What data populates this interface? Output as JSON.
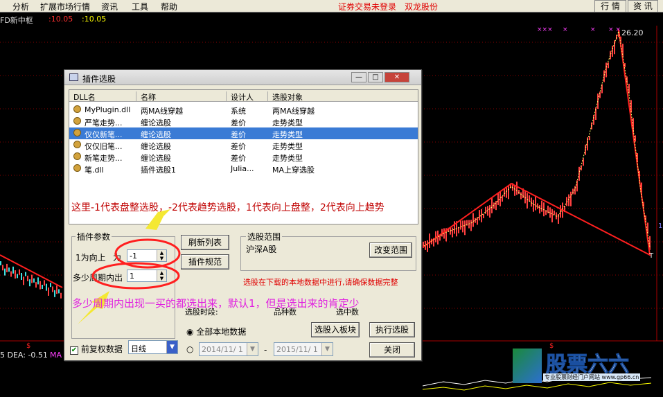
{
  "menu": {
    "items": [
      "分析",
      "扩展市场行情",
      "资讯",
      "工具",
      "帮助"
    ],
    "status": "证券交易未登录",
    "broker": "双龙股份",
    "btn_xinxi": "行 情",
    "btn_zixun": "资 讯"
  },
  "stock": {
    "name": "FD新中枢",
    "v1": ":10.05",
    "v2": ":10.05"
  },
  "chart": {
    "price_high": "26.20",
    "low_marker": "T",
    "dea_label": "5  DEA: -0.51",
    "ma_label": "MA",
    "right_tag": "1"
  },
  "dialog": {
    "title": "插件选股",
    "columns": [
      "DLL名",
      "名称",
      "设计人",
      "选股对象"
    ],
    "rows": [
      [
        "MyPlugin.dll",
        "两MA线穿越",
        "系统",
        "两MA线穿越"
      ],
      [
        "严笔走势...",
        "缠论选股",
        "差价",
        "走势类型"
      ],
      [
        "仅仅新笔...",
        "缠论选股",
        "差价",
        "走势类型"
      ],
      [
        "仅仅旧笔...",
        "缠论选股",
        "差价",
        "走势类型"
      ],
      [
        "新笔走势...",
        "缠论选股",
        "差价",
        "走势类型"
      ],
      [
        "笔.dll",
        "插件选股1",
        "Julia...",
        "MA上穿选股"
      ]
    ],
    "selected_row": 2,
    "plugin_params": "插件参数",
    "param1_label": "1为向上",
    "param1_label2": "为",
    "param1_value": "-1",
    "param2_label": "多少周期内出",
    "param2_value": "1",
    "refresh_list": "刷新列表",
    "plugin_spec": "插件规范",
    "range_title": "选股范围",
    "range_value": "沪深A股",
    "change_range": "改变范围",
    "notice": "选股在下载的本地数据中进行,请确保数据完整",
    "period_label": "选股时段:",
    "count_label": "品种数",
    "selected_label": "选中数",
    "radio_all": "全部本地数据",
    "date_from": "2014/11/ 1",
    "date_to": "2015/11/ 1",
    "dash": "-",
    "btn_add_block": "选股入板块",
    "btn_execute": "执行选股",
    "btn_close": "关闭",
    "reweight": "前复权数据",
    "period_value": "日线"
  },
  "annotations": {
    "a1": "这里-1代表盘整选股，-2代表趋势选股，1代表向上盘整，2代表向上趋势",
    "a2": "多少周期内出现一买的都选出来，默认1，但是选出来的肯定少"
  },
  "logo": {
    "brand": "股票六六",
    "sub": "专业股票财经门户网站 www.gp66.cn"
  },
  "colors": {
    "annotation_red": "#c00000",
    "annotation_magenta": "#e020e0",
    "ellipse_red": "#ff1f1f",
    "arrow_yellow": "#f4e832"
  }
}
